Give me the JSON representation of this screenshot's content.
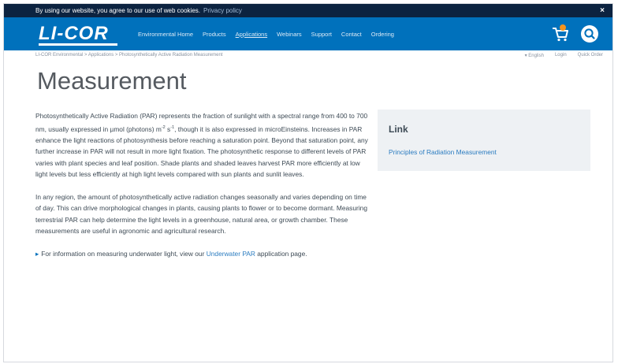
{
  "cookie_bar": {
    "text": "By using our website, you agree to our use of web cookies.",
    "policy_link": "Privacy policy",
    "close_symbol": "×"
  },
  "header": {
    "logo": "LI-COR",
    "nav": [
      "Environmental Home",
      "Products",
      "Applications",
      "Webinars",
      "Support",
      "Contact",
      "Ordering"
    ],
    "cart_icon": "cart-icon",
    "search_icon": "search-icon"
  },
  "breadcrumb": "LI-COR Environmental > Applications > Photosynthetically Active Radiation Measurement",
  "utility": {
    "language": "▾ English",
    "login": "Login",
    "quick_order": "Quick Order"
  },
  "page_title": "Measurement",
  "content": {
    "para1_text": "Photosynthetically Active Radiation (PAR) represents the fraction of sunlight with a spectral range from 400 to 700 nm, usually expressed in µmol (photons) m",
    "para1_exp1": "-2",
    "para1_mid": " s",
    "para1_exp2": "-1",
    "para1_rest": ", though it is also expressed in microEinsteins. Increases in PAR enhance the light reactions of photosynthesis before reaching a saturation point. Beyond that saturation point, any further increase in PAR will not result in more light fixation. The photosynthetic response to different levels of PAR varies with plant species and leaf position. Shade plants and shaded leaves harvest PAR more efficiently at low light levels but less efficiently at high light levels compared with sun plants and sunlit leaves.",
    "para2": "In any region, the amount of photosynthetically active radiation changes seasonally and varies depending on time of day. This can drive morphological changes in plants, causing plants to flower or to become dormant. Measuring terrestrial PAR can help determine the light levels in a greenhouse, natural area, or growth chamber. These measurements are useful in agronomic and agricultural research.",
    "note_arrow": "▸",
    "note_prefix": "For information on measuring underwater light, view our ",
    "note_link": "Underwater PAR",
    "note_suffix": " application page."
  },
  "sidebar": {
    "heading": "Link",
    "link": "Principles of Radiation Measurement"
  },
  "colors": {
    "header_blue": "#0071bc",
    "cookie_navy": "#0c2340",
    "link_blue": "#2b7cc0",
    "cart_badge": "#f7941d",
    "sidebar_bg": "#eef1f4"
  }
}
